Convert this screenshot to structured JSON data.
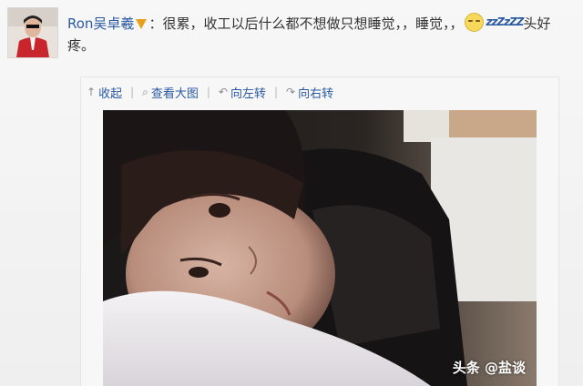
{
  "post": {
    "author": "Ron吴卓羲",
    "text_part1": "：很累，收工以后什么都不想做只想睡觉，，睡觉，，",
    "text_part2": "头好疼。",
    "emoticon_label": "zzZzZZ"
  },
  "toolbar": {
    "collapse_label": "收起",
    "view_large_label": "查看大图",
    "rotate_left_label": "向左转",
    "rotate_right_label": "向右转"
  },
  "icons": {
    "verified": "verified-badge-icon",
    "emoticon": "sleepy-face-icon",
    "collapse": "arrow-up-icon",
    "view_large": "magnify-icon",
    "rotate_left": "rotate-left-icon",
    "rotate_right": "rotate-right-icon"
  },
  "watermark": {
    "text": "头条 @盐谈"
  },
  "colors": {
    "link": "#2a5aa0",
    "verified": "#e8a01c",
    "text": "#333333"
  }
}
